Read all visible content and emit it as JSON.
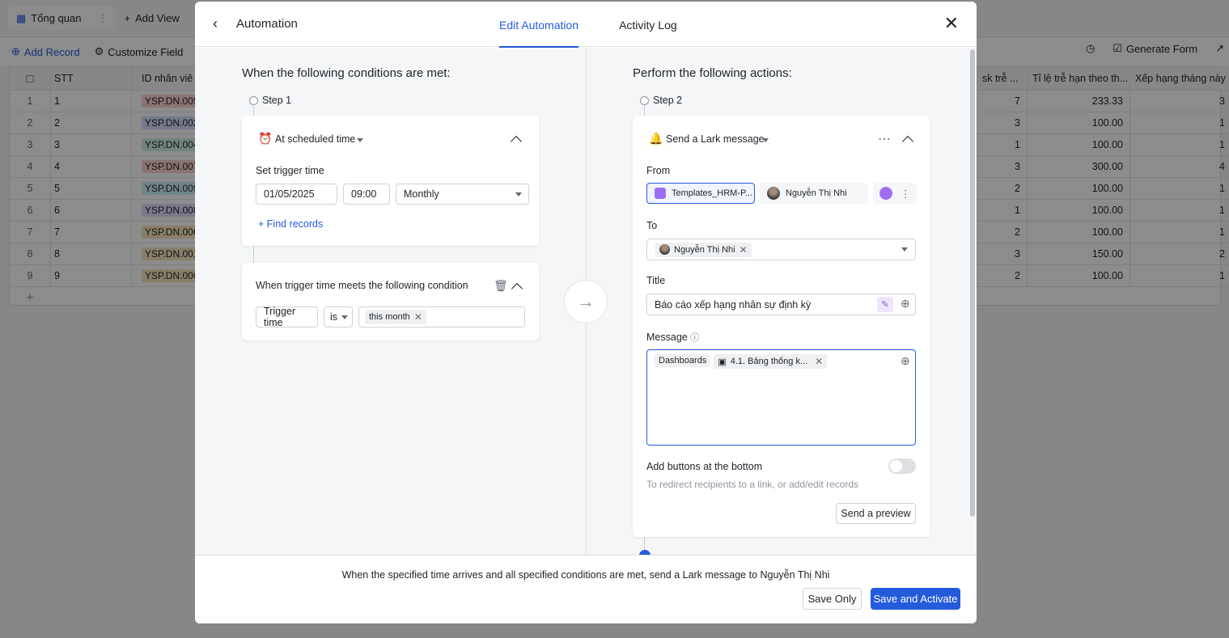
{
  "background": {
    "tabs": [
      {
        "label": "Tổng quan",
        "icon": "table-icon"
      },
      {
        "label": "Add View",
        "icon": "plus-icon"
      }
    ],
    "toolbar": {
      "add_record": "Add Record",
      "customize_field": "Customize Field",
      "generate_form": "Generate Form"
    },
    "grid": {
      "headers": {
        "stt": "STT",
        "id": "ID nhân viê",
        "col_a": "sk trễ ...",
        "col_b": "Tỉ lệ trễ hạn theo th...",
        "col_c": "Xếp hạng tháng này"
      },
      "rows": [
        {
          "n": "1",
          "stt": "1",
          "id": "YSP.DN.005",
          "a": "7",
          "b": "233.33",
          "c": "3",
          "color": "#fbd4d0"
        },
        {
          "n": "2",
          "stt": "2",
          "id": "YSP.DN.002",
          "a": "3",
          "b": "100.00",
          "c": "1",
          "color": "#d5dcf7"
        },
        {
          "n": "3",
          "stt": "3",
          "id": "YSP.DN.004",
          "a": "1",
          "b": "100.00",
          "c": "1",
          "color": "#cfeee0"
        },
        {
          "n": "4",
          "stt": "4",
          "id": "YSP.DN.007",
          "a": "3",
          "b": "300.00",
          "c": "4",
          "color": "#fbd4d0"
        },
        {
          "n": "5",
          "stt": "5",
          "id": "YSP.DN.009",
          "a": "2",
          "b": "100.00",
          "c": "1",
          "color": "#cdeff6"
        },
        {
          "n": "6",
          "stt": "6",
          "id": "YSP.DN.008",
          "a": "1",
          "b": "100.00",
          "c": "1",
          "color": "#e3dcfb"
        },
        {
          "n": "7",
          "stt": "7",
          "id": "YSP.DN.006",
          "a": "2",
          "b": "100.00",
          "c": "1",
          "color": "#f8e6bd"
        },
        {
          "n": "8",
          "stt": "8",
          "id": "YSP.DN.001",
          "a": "3",
          "b": "150.00",
          "c": "2",
          "color": "#f8e6bd"
        },
        {
          "n": "9",
          "stt": "9",
          "id": "YSP.DN.006",
          "a": "2",
          "b": "100.00",
          "c": "1",
          "color": "#f8e6bd"
        }
      ]
    }
  },
  "modal": {
    "title": "Automation",
    "tabs": [
      {
        "label": "Edit Automation",
        "active": true
      },
      {
        "label": "Activity Log",
        "active": false
      }
    ],
    "left": {
      "heading": "When the following conditions are met:",
      "step_label": "Step 1",
      "trigger": {
        "type": "At scheduled time",
        "set_time_label": "Set trigger time",
        "date": "01/05/2025",
        "time": "09:00",
        "frequency": "Monthly",
        "find_records": "Find records"
      },
      "condition": {
        "title": "When trigger time meets the following condition",
        "field": "Trigger time",
        "operator": "is",
        "value": "this month"
      }
    },
    "right": {
      "heading": "Perform the following actions:",
      "step_label": "Step 2",
      "action": {
        "type": "Send a Lark message",
        "from_label": "From",
        "from_app": "Templates_HRM-P...",
        "from_user": "Nguyễn Thị Nhi",
        "to_label": "To",
        "to_user": "Nguyễn Thị Nhi",
        "title_label": "Title",
        "title_value": "Báo cáo xếp hạng nhân sự định kỳ",
        "message_label": "Message",
        "message_chip_a": "Dashboards",
        "message_chip_b": "4.1. Bảng thống k...",
        "bottom_buttons_label": "Add buttons at the bottom",
        "bottom_buttons_hint": "To redirect recipients to a link, or add/edit records",
        "bottom_buttons_on": false,
        "preview_button": "Send a preview"
      }
    },
    "footer": {
      "summary": "When the specified time arrives and all specified conditions are met, send a Lark message to Nguyễn Thị Nhi",
      "save_only": "Save Only",
      "save_activate": "Save and Activate"
    },
    "accent_color": "#245bdb"
  }
}
